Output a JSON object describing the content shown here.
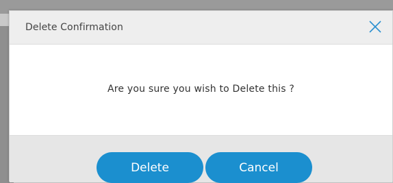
{
  "dialog": {
    "title": "Delete Confirmation",
    "close_icon": "close-icon",
    "message": "Are you sure you wish to Delete this ?",
    "buttons": {
      "delete_label": "Delete",
      "cancel_label": "Cancel"
    }
  },
  "colors": {
    "button": "#1b8fcf",
    "close_icon": "#2a8fd0",
    "header_bg": "#eeeeee",
    "footer_bg": "#e6e6e6"
  }
}
